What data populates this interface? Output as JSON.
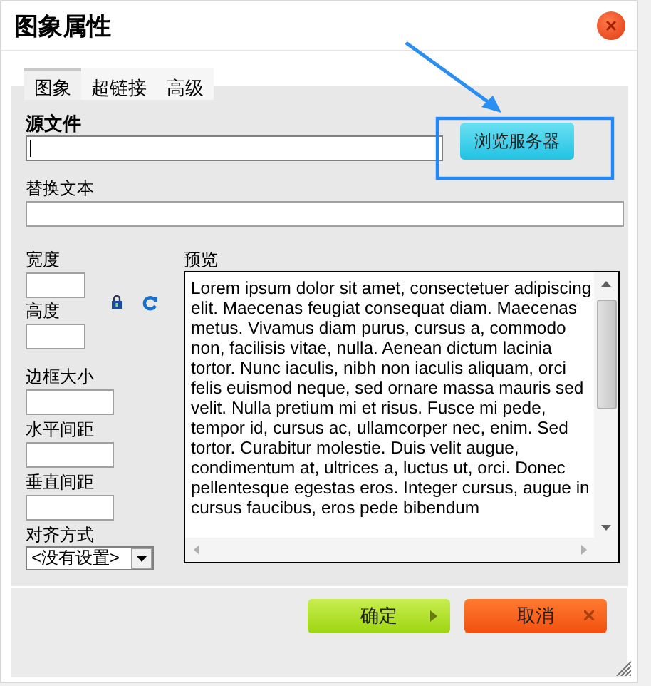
{
  "dialog": {
    "title": "图象属性"
  },
  "tabs": [
    {
      "label": "图象",
      "selected": true
    },
    {
      "label": "超链接",
      "selected": false
    },
    {
      "label": "高级",
      "selected": false
    }
  ],
  "source": {
    "label": "源文件",
    "focused": true
  },
  "browse_button": "浏览服务器",
  "alt_text": {
    "label": "替换文本"
  },
  "size_fields": [
    {
      "label": "宽度"
    },
    {
      "label": "高度"
    }
  ],
  "spacing_fields": [
    {
      "label": "边框大小"
    },
    {
      "label": "水平间距"
    },
    {
      "label": "垂直间距"
    }
  ],
  "align": {
    "label": "对齐方式",
    "value": "<没有设置>"
  },
  "preview": {
    "label": "预览",
    "text": "Lorem ipsum dolor sit amet, consectetuer adipiscing elit. Maecenas feugiat consequat diam. Maecenas metus. Vivamus diam purus, cursus a, commodo non, facilisis vitae, nulla. Aenean dictum lacinia tortor. Nunc iaculis, nibh non iaculis aliquam, orci felis euismod neque, sed ornare massa mauris sed velit. Nulla pretium mi et risus. Fusce mi pede, tempor id, cursus ac, ullamcorper nec, enim. Sed tortor. Curabitur molestie. Duis velit augue, condimentum at, ultrices a, luctus ut, orci. Donec pellentesque egestas eros. Integer cursus, augue in cursus faucibus, eros pede bibendum"
  },
  "buttons": [
    {
      "label": "确定",
      "kind": "ok"
    },
    {
      "label": "取消",
      "kind": "cancel"
    }
  ]
}
